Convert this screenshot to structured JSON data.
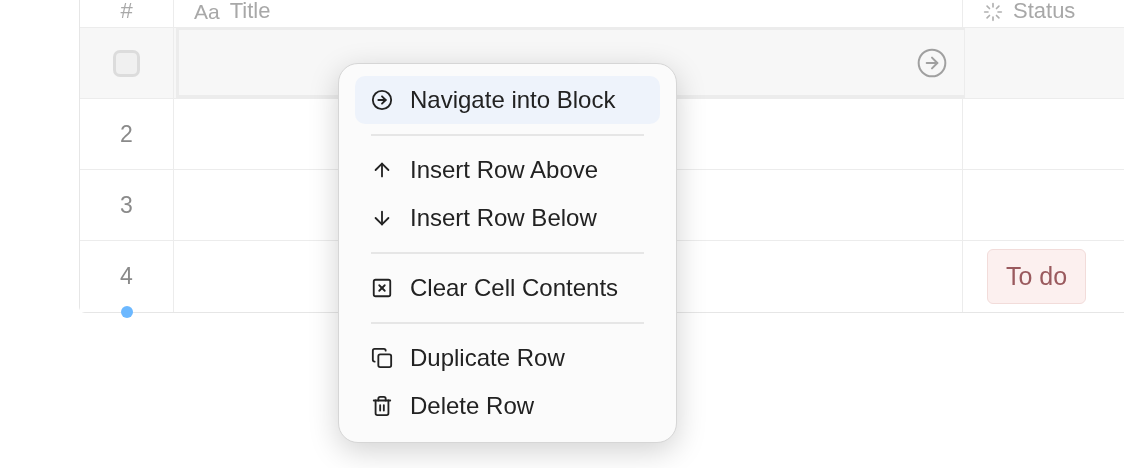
{
  "table": {
    "columns": [
      {
        "label": "#",
        "kind": "number"
      },
      {
        "label": "Title",
        "kind": "title",
        "prefix": "Aa"
      },
      {
        "label": "Status",
        "kind": "status"
      }
    ],
    "rows": [
      {
        "kind": "checkbox",
        "checked": false,
        "title_selected": true
      },
      {
        "kind": "number",
        "number": "2",
        "title_selected": false
      },
      {
        "kind": "number",
        "number": "3",
        "title_selected": false
      },
      {
        "kind": "number",
        "number": "4",
        "title_selected": false,
        "status": "To do"
      }
    ]
  },
  "context_menu": {
    "sections": [
      [
        {
          "label": "Navigate into Block",
          "kind": "navigate",
          "highlighted": true
        }
      ],
      [
        {
          "label": "Insert Row Above",
          "kind": "up",
          "highlighted": false
        },
        {
          "label": "Insert Row Below",
          "kind": "down",
          "highlighted": false
        }
      ],
      [
        {
          "label": "Clear Cell Contents",
          "kind": "clear",
          "highlighted": false
        }
      ],
      [
        {
          "label": "Duplicate Row",
          "kind": "duplicate",
          "highlighted": false
        },
        {
          "label": "Delete Row",
          "kind": "delete",
          "highlighted": false
        }
      ]
    ]
  }
}
